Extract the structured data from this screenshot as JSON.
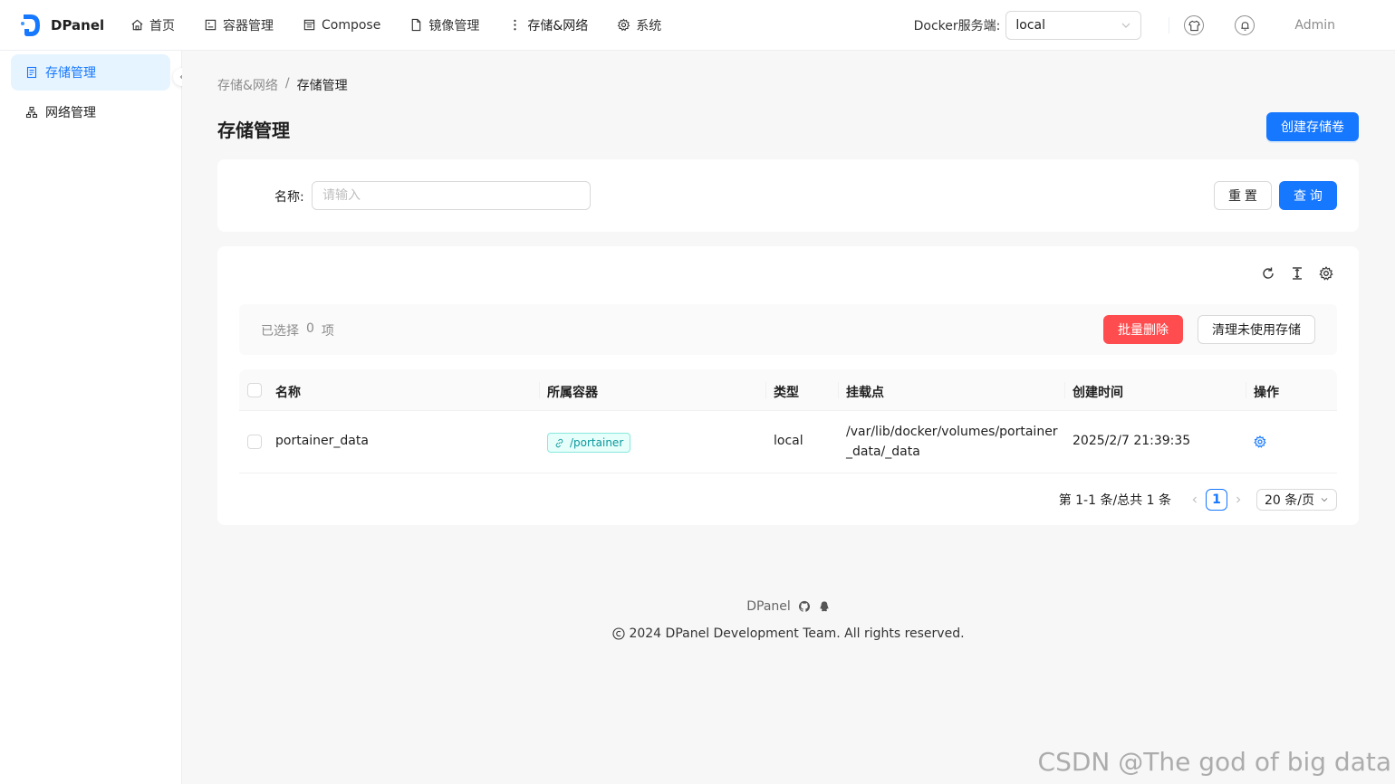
{
  "app": {
    "name": "DPanel"
  },
  "nav": {
    "items": [
      {
        "label": "首页",
        "icon": "home-icon"
      },
      {
        "label": "容器管理",
        "icon": "container-icon"
      },
      {
        "label": "Compose",
        "icon": "compose-icon"
      },
      {
        "label": "镜像管理",
        "icon": "file-icon"
      },
      {
        "label": "存储&网络",
        "icon": "more-vertical-icon"
      },
      {
        "label": "系统",
        "icon": "gear-icon"
      }
    ]
  },
  "header": {
    "docker_label": "Docker服务端:",
    "docker_value": "local",
    "user": "Admin"
  },
  "sidebar": {
    "items": [
      {
        "label": "存储管理",
        "icon": "storage-icon",
        "active": true
      },
      {
        "label": "网络管理",
        "icon": "network-icon",
        "active": false
      }
    ]
  },
  "breadcrumb": {
    "parent": "存储&网络",
    "separator": "/",
    "current": "存储管理"
  },
  "page": {
    "title": "存储管理",
    "create_label": "创建存储卷"
  },
  "search": {
    "label": "名称:",
    "placeholder": "请输入",
    "value": "",
    "reset_label": "重 置",
    "query_label": "查 询"
  },
  "selection": {
    "prefix": "已选择",
    "count": "0",
    "suffix": "项",
    "batch_delete_label": "批量删除",
    "clean_label": "清理未使用存储"
  },
  "table": {
    "columns": [
      "名称",
      "所属容器",
      "类型",
      "挂载点",
      "创建时间",
      "操作"
    ],
    "rows": [
      {
        "name": "portainer_data",
        "container": "/portainer",
        "type": "local",
        "mount": "/var/lib/docker/volumes/portainer_data/_data",
        "created": "2025/2/7 21:39:35"
      }
    ]
  },
  "pagination": {
    "total_text": "第 1-1 条/总共 1 条",
    "current_page": "1",
    "page_size": "20 条/页"
  },
  "footer": {
    "brand": "DPanel",
    "copyright": "2024 DPanel Development Team. All rights reserved."
  },
  "watermark": "CSDN @The god of big data",
  "colors": {
    "primary": "#1677ff",
    "danger": "#ff4d4f",
    "tag_bg": "#e6fffb",
    "tag_text": "#08979c"
  }
}
